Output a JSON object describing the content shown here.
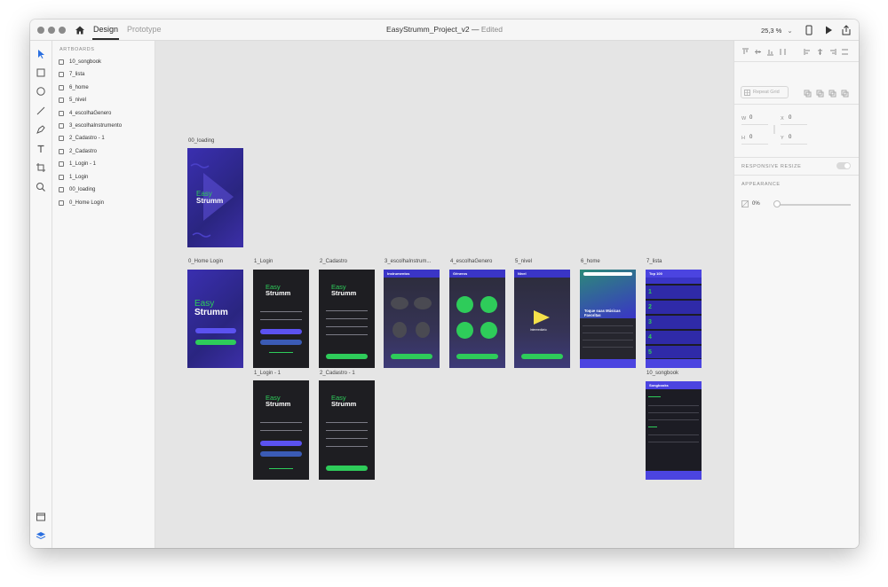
{
  "window": {
    "tabs": [
      "Design",
      "Prototype"
    ],
    "doc_name": "EasyStrumm_Project_v2",
    "doc_sep": " — ",
    "doc_status": "Edited",
    "zoom": "25,3 %"
  },
  "layers": {
    "heading": "ARTBOARDS",
    "items": [
      "10_songbook",
      "7_lista",
      "6_home",
      "5_nivel",
      "4_escolhaGenero",
      "3_escolhaInstrumento",
      "2_Cadastro - 1",
      "2_Cadastro",
      "1_Login - 1",
      "1_Login",
      "00_loading",
      "0_Home Login"
    ]
  },
  "artboard_labels": {
    "loading": "00_loading",
    "home_login": "0_Home Login",
    "login": "1_Login",
    "cadastro": "2_Cadastro",
    "instr": "3_escolhaInstrum...",
    "genero": "4_escolhaGenero",
    "nivel": "5_nivel",
    "home": "6_home",
    "lista": "7_lista",
    "login1": "1_Login - 1",
    "cadastro1": "2_Cadastro - 1",
    "songbook": "10_songbook"
  },
  "logo": {
    "line1": "Easy",
    "line2": "Strumm"
  },
  "screens": {
    "instr_title": "Instrumentos",
    "genero_title": "Gêneros",
    "nivel_title": "Nível",
    "nivel_level": "Intermediário",
    "home_hero": "Toque suas Músicas Favoritas",
    "lista_title": "Top 100",
    "songbook_title": "Songbooks",
    "login_btn": "ENTRAR",
    "continue_btn": "CONTINUAR",
    "signup_btn": "CADASTRAR"
  },
  "inspector": {
    "repeat_grid": "Repeat Grid",
    "w_label": "W",
    "w_val": "0",
    "x_label": "X",
    "x_val": "0",
    "h_label": "H",
    "h_val": "0",
    "y_label": "Y",
    "y_val": "0",
    "responsive": "RESPONSIVE RESIZE",
    "appearance": "APPEARANCE",
    "opacity": "0%"
  },
  "colors": {
    "green": "#2ecc5a",
    "purple": "#4b44e0",
    "dark": "#1e1e22",
    "yellow": "#f5e14a"
  }
}
